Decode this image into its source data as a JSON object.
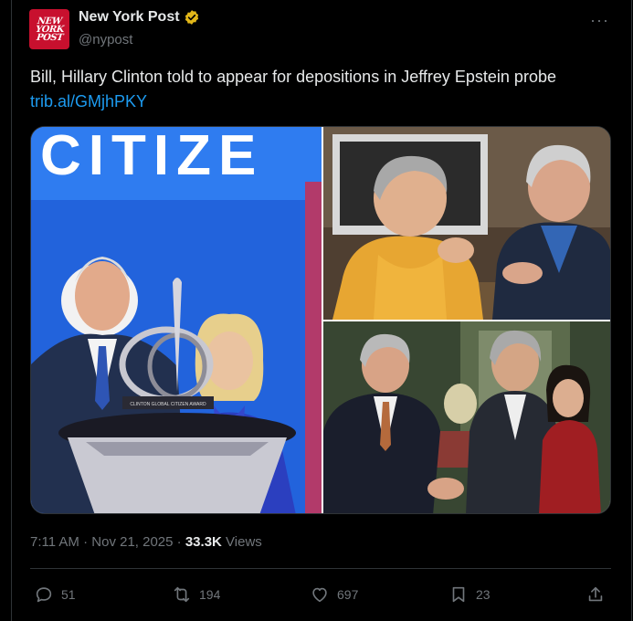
{
  "account": {
    "name": "New York Post",
    "handle": "@nypost",
    "avatar_text": [
      "NEW",
      "YORK",
      "POST"
    ]
  },
  "more_label": "···",
  "tweet": {
    "text": "Bill, Hillary Clinton told to appear for depositions in Jeffrey Epstein probe",
    "link": "trib.al/GMjhPKY"
  },
  "media": {
    "stage_text": "CITIZE",
    "award_label": "CLINTON GLOBAL CITIZEN AWARD"
  },
  "meta": {
    "time": "7:11 AM",
    "sep1": " · ",
    "date": "Nov 21, 2025",
    "sep2": " · ",
    "views_count": "33.3K",
    "views_label": " Views"
  },
  "actions": {
    "replies": "51",
    "reposts": "194",
    "likes": "697",
    "bookmarks": "23"
  },
  "colors": {
    "background": "#000000",
    "link": "#1d9bf0",
    "muted": "#71767b",
    "verified": "#e2b719",
    "brand": "#c8102e"
  }
}
